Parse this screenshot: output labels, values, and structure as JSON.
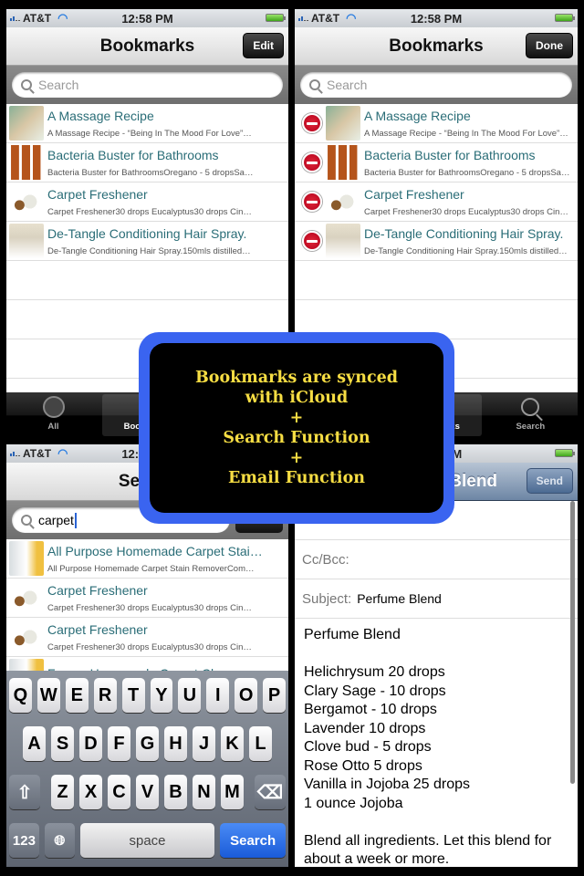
{
  "status": {
    "carrier": "AT&T",
    "time": "12:58 PM"
  },
  "bookmarks": {
    "title": "Bookmarks",
    "edit_label": "Edit",
    "done_label": "Done",
    "search_placeholder": "Search",
    "items": [
      {
        "title": "A Massage Recipe",
        "subtitle": "A Massage Recipe - “Being In The Mood For Love”…",
        "thumb": "massage-oils"
      },
      {
        "title": "Bacteria Buster for Bathrooms",
        "subtitle": "Bacteria Buster for BathroomsOregano - 5 dropsSa…",
        "thumb": "amber-bottles"
      },
      {
        "title": "Carpet Freshener",
        "subtitle": "Carpet Freshener30 drops Eucalyptus30 drops Cin…",
        "thumb": "spray-bottle"
      },
      {
        "title": "De-Tangle Conditioning Hair Spray.",
        "subtitle": "De-Tangle Conditioning Hair Spray.150mls distilled…",
        "thumb": "cream-jar"
      }
    ]
  },
  "tabbar": {
    "tabs": [
      {
        "label": "All",
        "icon": "globe-icon"
      },
      {
        "label": "Bookmarks",
        "icon": "bookmarks-icon",
        "active": true
      },
      {
        "label": "Search",
        "icon": "search-icon"
      }
    ]
  },
  "search_screen": {
    "title": "Search",
    "query": "carpet",
    "results": [
      {
        "title": "All Purpose Homemade Carpet Stai…",
        "subtitle": "All Purpose Homemade Carpet Stain RemoverCom…"
      },
      {
        "title": "Carpet Freshener",
        "subtitle": "Carpet Freshener30 drops Eucalyptus30 drops Cin…"
      },
      {
        "title": "Carpet Freshener",
        "subtitle": "Carpet Freshener30 drops Eucalyptus30 drops Cin…"
      },
      {
        "title": "Foamy Homemade Carpet Cleaner…",
        "subtitle": ""
      }
    ]
  },
  "keyboard": {
    "row1": [
      "Q",
      "W",
      "E",
      "R",
      "T",
      "Y",
      "U",
      "I",
      "O",
      "P"
    ],
    "row2": [
      "A",
      "S",
      "D",
      "F",
      "G",
      "H",
      "J",
      "K",
      "L"
    ],
    "row3": [
      "Z",
      "X",
      "C",
      "V",
      "B",
      "N",
      "M"
    ],
    "numbers_label": "123",
    "space_label": "space",
    "search_label": "Search"
  },
  "mail": {
    "title": "Perfume Blend",
    "send_label": "Send",
    "cc_label": "Cc/Bcc:",
    "subject_label": "Subject:",
    "subject_value": "Perfume Blend",
    "body": [
      "Perfume Blend",
      "",
      "Helichrysum 20 drops",
      "Clary Sage - 10 drops",
      "Bergamot - 10 drops",
      "Lavender 10 drops",
      "Clove bud - 5 drops",
      "Rose Otto 5 drops",
      "Vanilla in Jojoba 25 drops",
      "1 ounce Jojoba",
      "",
      "Blend all ingredients. Let this blend for",
      "about a week or more."
    ]
  },
  "overlay": {
    "lines": [
      "Bookmarks are synced",
      "with iCloud",
      "+",
      "Search Function",
      "+",
      "Email Function"
    ],
    "border_color": "#3a64f0",
    "text_color": "#f6dd43"
  }
}
